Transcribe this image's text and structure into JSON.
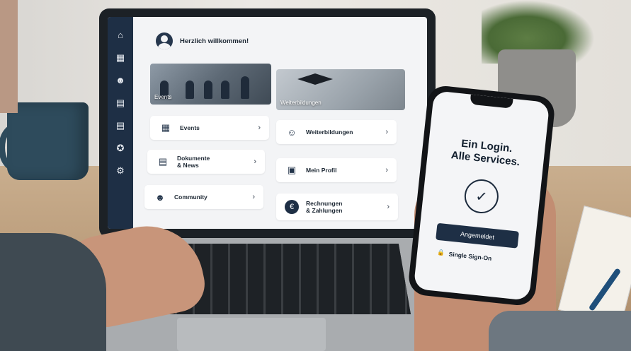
{
  "sidebar": {
    "icons": [
      "home-icon",
      "calendar-icon",
      "people-icon",
      "document-icon",
      "document-icon",
      "badge-icon",
      "settings-icon"
    ]
  },
  "welcome": {
    "text": "Herzlich willkommen!"
  },
  "cards": {
    "events_image_label": "Events",
    "weiterbildungen_image_label": "Weiterbildungen"
  },
  "tiles": [
    {
      "label": "Events",
      "icon": "calendar-list-icon"
    },
    {
      "label": "Weiterbildungen",
      "icon": "person-training-icon"
    },
    {
      "label_line1": "Dokumente",
      "label_line2": "& News",
      "icon": "document-icon"
    },
    {
      "label": "Mein Profil",
      "icon": "profile-icon"
    },
    {
      "label": "Community",
      "icon": "people-icon"
    },
    {
      "label_line1": "Rechnungen",
      "label_line2": "& Zahlungen",
      "icon": "euro-icon"
    }
  ],
  "phone": {
    "title_line1": "Ein Login.",
    "title_line2": "Alle Services.",
    "button": "Angemeldet",
    "sso": "Single Sign-On"
  },
  "colors": {
    "sidebar": "#1e2f45",
    "accent": "#1e2f45"
  }
}
